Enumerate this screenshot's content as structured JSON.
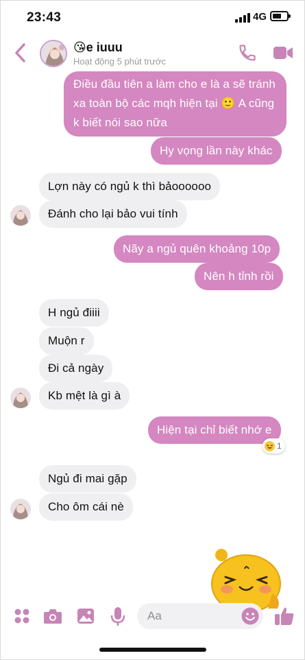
{
  "status_bar": {
    "time": "23:43",
    "network": "4G",
    "signal_bars": 4,
    "battery_level": 0.65
  },
  "header": {
    "name": "😘e iuuu",
    "status": "Hoạt động 5 phút trước"
  },
  "messages": [
    {
      "from": "me",
      "text": "Điều đầu tiên a làm cho e là a sẽ tránh xa toàn bộ các mqh hiện tại 🙂 A cũng k biết nói sao nữa"
    },
    {
      "from": "me",
      "text": "Hy vọng lần này khác"
    },
    {
      "from": "them",
      "text": "Lợn này có ngủ k thì bảoooooo"
    },
    {
      "from": "them",
      "text": "Đánh cho lại bảo vui tính"
    },
    {
      "from": "me",
      "text": "Nãy a ngủ quên khoảng 10p"
    },
    {
      "from": "me",
      "text": "Nên h tỉnh rồi"
    },
    {
      "from": "them",
      "text": "H ngủ điiii"
    },
    {
      "from": "them",
      "text": "Muộn r"
    },
    {
      "from": "them",
      "text": "Đi cả ngày"
    },
    {
      "from": "them",
      "text": "Kb mệt là gì à"
    },
    {
      "from": "me",
      "text": "Hiện tại chỉ biết nhớ e"
    },
    {
      "from": "them",
      "text": "Ngủ đi mai gặp"
    },
    {
      "from": "them",
      "text": "Cho ôm cái nè"
    }
  ],
  "reaction": {
    "emoji": "laughing-emoji",
    "count": "1"
  },
  "composer": {
    "placeholder": "Aa"
  },
  "colors": {
    "accent": "#d487c0",
    "incoming_bubble": "#efeef0",
    "icon_tint": "#c784b6"
  }
}
